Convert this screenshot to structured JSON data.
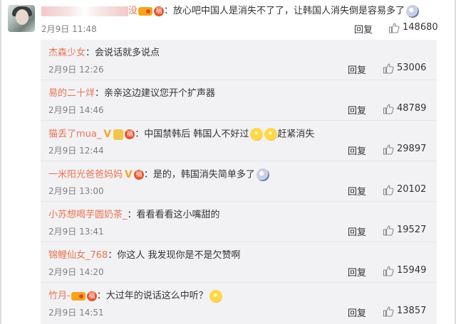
{
  "main": {
    "username_tail": "没",
    "text": "：放心吧中国人是消失不了了，让韩国人消失倒是容易多了",
    "time": "2月9日 11:48",
    "reply_label": "回复",
    "likes": "148680"
  },
  "badge_char": "福",
  "replies": [
    {
      "user": "杰森少女",
      "text": "：会说话就多说点",
      "time": "2月9日 12:26",
      "reply_label": "回复",
      "likes": "53006"
    },
    {
      "user": "易的二十烊",
      "text": "：亲亲这边建议您开个扩声器",
      "time": "2月9日 14:46",
      "reply_label": "回复",
      "likes": "48789"
    },
    {
      "user": "猫丢了mua_",
      "text_a": "：中国禁韩后 韩国人不好过",
      "text_b": "赶紧消失",
      "time": "2月9日 12:44",
      "reply_label": "回复",
      "likes": "29897"
    },
    {
      "user": "一米阳光爸爸妈妈",
      "text": "：是的，韩国消失简单多了",
      "time": "2月9日 13:00",
      "reply_label": "回复",
      "likes": "20102"
    },
    {
      "user": "小苏想喝芋圆奶茶_",
      "text": "：看看看看这小嘴甜的",
      "time": "2月9日 13:41",
      "reply_label": "回复",
      "likes": "19527"
    },
    {
      "user": "锦鲤仙女_768",
      "text": "：你这人 我发现你是不是欠赞啊",
      "time": "2月9日 14:20",
      "reply_label": "回复",
      "likes": "15949"
    },
    {
      "user": "竹月-",
      "text": "：大过年的说话这么中听？",
      "time": "2月9日 14:51",
      "reply_label": "回复",
      "likes": "13857"
    }
  ]
}
